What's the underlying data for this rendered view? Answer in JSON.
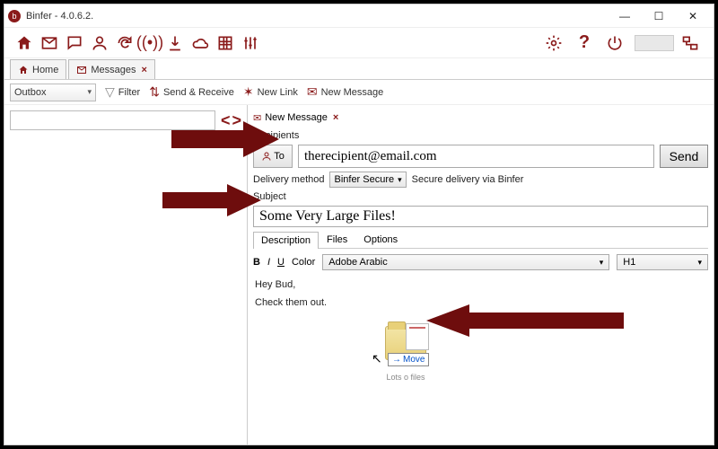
{
  "titlebar": {
    "app": "Binfer",
    "version": "4.0.6.2."
  },
  "tabs": {
    "home": "Home",
    "messages": "Messages"
  },
  "toolbar2": {
    "mailbox_selected": "Outbox",
    "filter": "Filter",
    "send_receive": "Send & Receive",
    "new_link": "New Link",
    "new_message": "New Message"
  },
  "compose": {
    "tab_label": "New Message",
    "recipients_label": "Recipients",
    "to_button": "To",
    "to_value": "therecipient@email.com",
    "send": "Send",
    "delivery_label": "Delivery method",
    "delivery_value": "Binfer Secure",
    "delivery_desc": "Secure delivery via Binfer",
    "subject_label": "Subject",
    "subject_value": "Some Very Large Files!",
    "subtabs": {
      "description": "Description",
      "files": "Files",
      "options": "Options"
    },
    "format": {
      "b": "B",
      "i": "I",
      "u": "U",
      "color": "Color",
      "font": "Adobe Arabic",
      "size": "H1"
    },
    "body_line1": "Hey Bud,",
    "body_line2": "Check them out.",
    "drop": {
      "tooltip": "Move",
      "folder_label": "Lots o files"
    }
  }
}
